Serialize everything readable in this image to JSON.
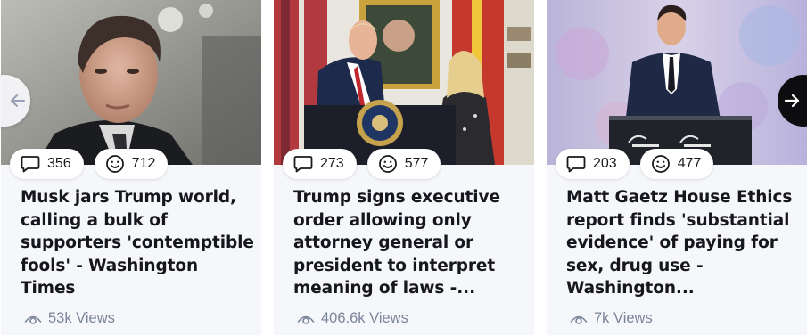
{
  "cards": [
    {
      "comments": "356",
      "reactions": "712",
      "title": "Musk jars Trump world, calling a bulk of supporters 'contemptible fools' - Washington Times",
      "views": "53k Views"
    },
    {
      "comments": "273",
      "reactions": "577",
      "title": "Trump signs executive order allowing only attorney general or president to interpret meaning of laws -...",
      "views": "406.6k Views"
    },
    {
      "comments": "203",
      "reactions": "477",
      "title": "Matt Gaetz House Ethics report finds 'substantial evidence' of paying for sex, drug use - Washington...",
      "views": "7k Views"
    }
  ],
  "icons": {
    "comments": "comment-bubble-icon",
    "reactions": "smiley-face-icon",
    "views": "eye-icon",
    "prev": "arrow-left-icon",
    "next": "arrow-right-icon"
  },
  "colors": {
    "card_background": "#f6f7fa",
    "title_text": "#16161d",
    "views_text": "#7b8599",
    "next_button": "#0d0d10"
  }
}
